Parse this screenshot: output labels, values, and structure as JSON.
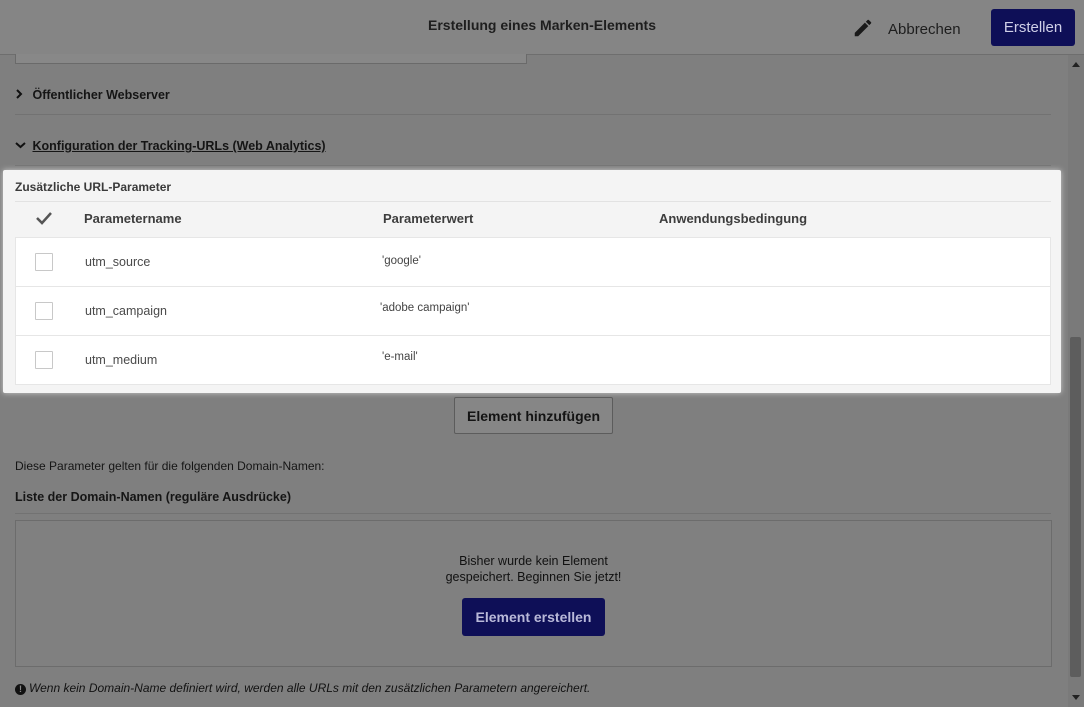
{
  "header": {
    "title": "Erstellung eines Marken-Elements",
    "edit_icon": "pencil-icon",
    "cancel_label": "Abbrechen",
    "create_label": "Erstellen"
  },
  "sections": {
    "webserver": "Öffentlicher Webserver",
    "tracking": "Konfiguration der Tracking-URLs (Web Analytics)"
  },
  "panel": {
    "title": "Zusätzliche URL-Parameter",
    "columns": [
      "Parametername",
      "Parameterwert",
      "Anwendungsbedingung"
    ],
    "rows": [
      {
        "name": "utm_source",
        "value": "'google'",
        "condition": ""
      },
      {
        "name": "utm_campaign",
        "value": "'adobe campaign'",
        "condition": ""
      },
      {
        "name": "utm_medium",
        "value": "'e-mail'",
        "condition": ""
      }
    ]
  },
  "add_button_label": "Element hinzufügen",
  "domain_info": "Diese Parameter gelten für die folgenden Domain-Namen:",
  "domain_list_title": "Liste der Domain-Namen (reguläre Ausdrücke)",
  "empty_state": {
    "line1": "Bisher wurde kein Element",
    "line2": "gespeichert. Beginnen Sie jetzt!",
    "button_label": "Element erstellen"
  },
  "footnote": "Wenn kein Domain-Name definiert wird, werden alle URLs mit den zusätzlichen Parametern angereichert.",
  "colors": {
    "primary_button": "#0e0f57",
    "overlay": "#7f7f7f",
    "panel_bg": "#f4f4f4"
  }
}
